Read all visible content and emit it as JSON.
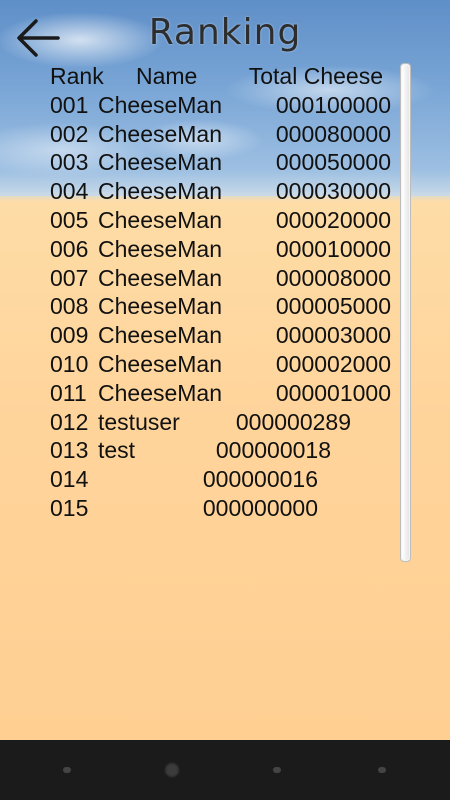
{
  "title": "Ranking",
  "icons": {
    "back": "arrow-left-icon"
  },
  "table": {
    "headers": {
      "rank": "Rank",
      "name": "Name",
      "total": "Total Cheese"
    },
    "rows": [
      {
        "rank": "001",
        "name": "CheeseMan",
        "score": "000100000"
      },
      {
        "rank": "002",
        "name": "CheeseMan",
        "score": "000080000"
      },
      {
        "rank": "003",
        "name": "CheeseMan",
        "score": "000050000"
      },
      {
        "rank": "004",
        "name": "CheeseMan",
        "score": "000030000"
      },
      {
        "rank": "005",
        "name": "CheeseMan",
        "score": "000020000"
      },
      {
        "rank": "006",
        "name": "CheeseMan",
        "score": "000010000"
      },
      {
        "rank": "007",
        "name": "CheeseMan",
        "score": "000008000"
      },
      {
        "rank": "008",
        "name": "CheeseMan",
        "score": "000005000"
      },
      {
        "rank": "009",
        "name": "CheeseMan",
        "score": "000003000"
      },
      {
        "rank": "010",
        "name": "CheeseMan",
        "score": "000002000"
      },
      {
        "rank": "011",
        "name": "CheeseMan",
        "score": "000001000"
      },
      {
        "rank": "012",
        "name": "testuser",
        "score": "000000289"
      },
      {
        "rank": "013",
        "name": "test",
        "score": "000000018"
      },
      {
        "rank": "014",
        "name": "",
        "score": "000000016"
      },
      {
        "rank": "015",
        "name": "",
        "score": "000000000"
      }
    ]
  },
  "colors": {
    "text": "#111111",
    "sky": "#7aa6d6",
    "ground": "#ffd49b"
  }
}
